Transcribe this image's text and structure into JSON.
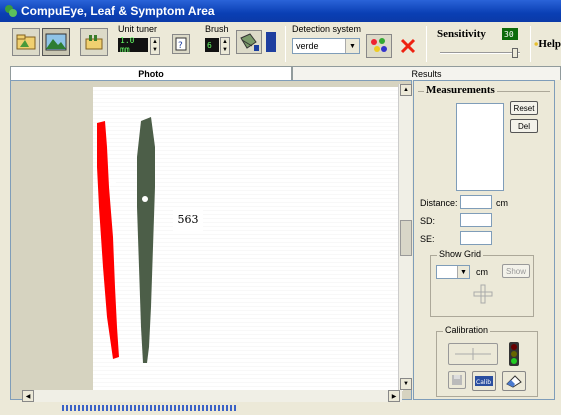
{
  "window": {
    "title": "CompuEye, Leaf & Symptom Area"
  },
  "toolbar": {
    "unit_tuner_label": "Unit tuner",
    "unit_tuner_value": "1.0 mm",
    "brush_label": "Brush",
    "brush_value": "6",
    "detection_label": "Detection system",
    "detection_value": "verde",
    "sensitivity_label": "Sensitivity",
    "sensitivity_value": "30",
    "help_label": "Help"
  },
  "tabs": [
    {
      "label": "Photo",
      "active": true
    },
    {
      "label": "Results",
      "active": false
    }
  ],
  "photo": {
    "sample_label": "563"
  },
  "measurements": {
    "title": "Measurements",
    "reset_label": "Reset",
    "del_label": "Del",
    "distance_label": "Distance:",
    "distance_unit": "cm",
    "sd_label": "SD:",
    "se_label": "SE:"
  },
  "grid": {
    "title": "Show Grid",
    "unit": "cm",
    "show_label": "Show"
  },
  "calibration": {
    "title": "Calibration",
    "calib_label": "Calib"
  },
  "colors": {
    "leaf_detected": "#ff0000",
    "leaf": "#4c5e48",
    "titlebar": "#0a3fb4"
  }
}
